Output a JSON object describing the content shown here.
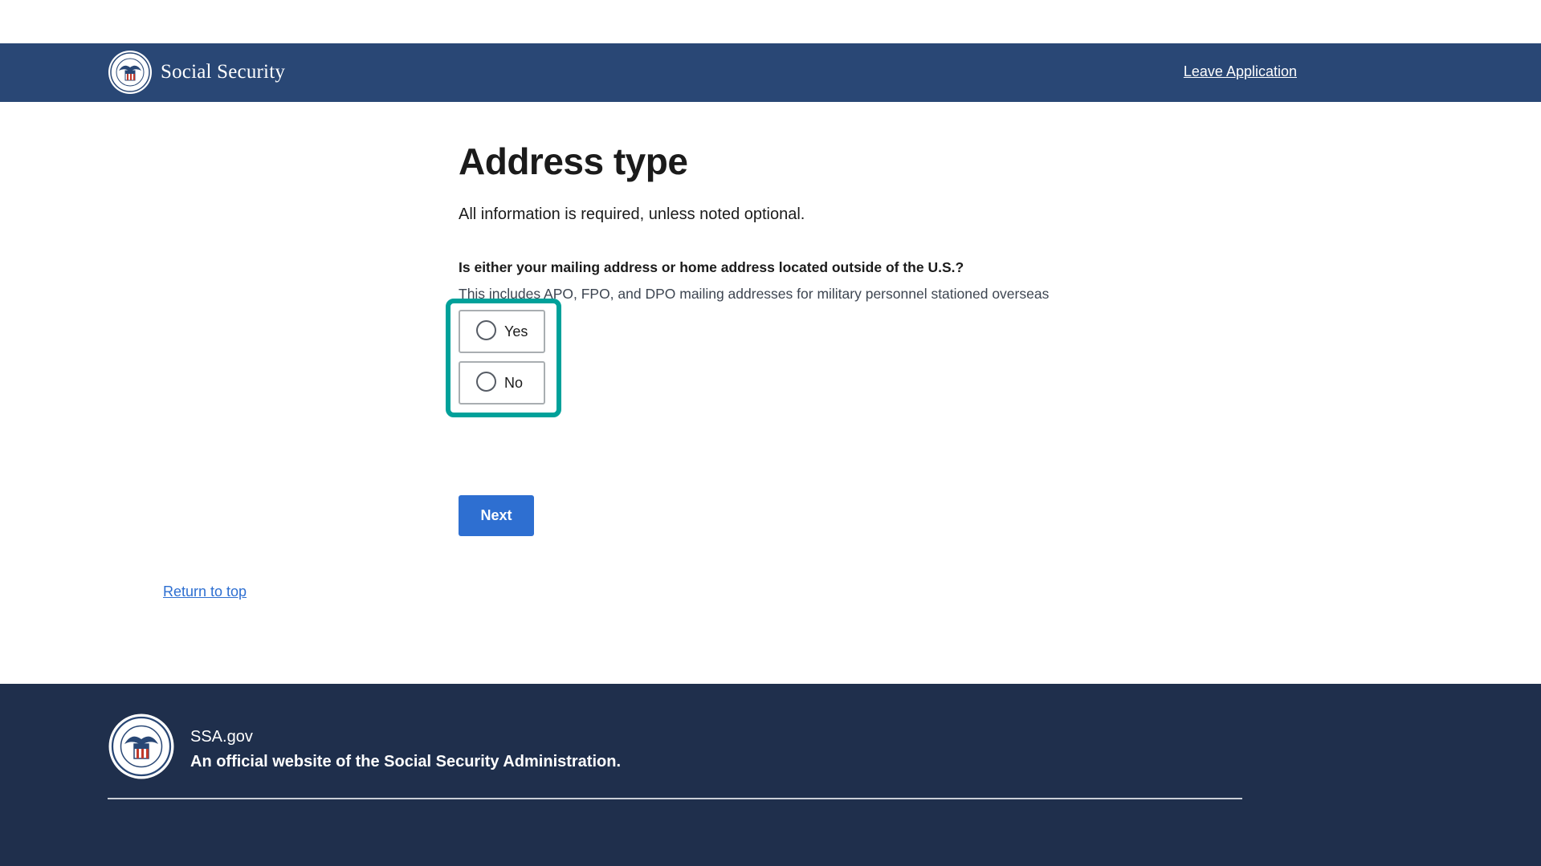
{
  "header": {
    "brand_name": "Social Security",
    "leave_link": "Leave Application"
  },
  "main": {
    "title": "Address type",
    "intro": "All information is required, unless noted optional.",
    "question": "Is either your mailing address or home address located outside of the U.S.?",
    "hint": "This includes APO, FPO, and DPO mailing addresses for military personnel stationed overseas",
    "options": [
      {
        "label": "Yes",
        "selected": false
      },
      {
        "label": "No",
        "selected": false
      }
    ],
    "next_label": "Next",
    "return_to_top": "Return to top"
  },
  "footer": {
    "site": "SSA.gov",
    "official": "An official website of the Social Security Administration."
  },
  "colors": {
    "header_bg": "#294775",
    "footer_bg": "#1f2f4c",
    "primary_button": "#2e6fd1",
    "highlight": "#00a19a"
  },
  "icons": {
    "seal": "ssa-seal-icon",
    "radio": "radio-circle-icon"
  }
}
